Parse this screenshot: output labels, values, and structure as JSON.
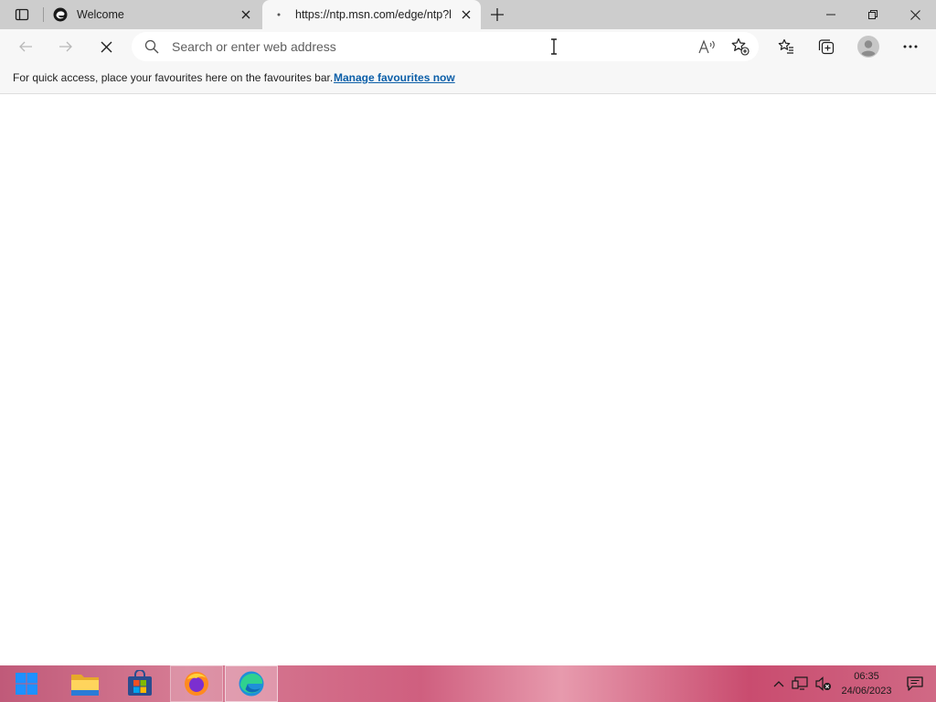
{
  "tabs": [
    {
      "title": "Welcome",
      "icon": "edge-logo-icon",
      "active": false
    },
    {
      "title": "https://ntp.msn.com/edge/ntp?l",
      "icon": "loading-dot-icon",
      "active": true
    }
  ],
  "address_bar": {
    "placeholder": "Search or enter web address",
    "value": ""
  },
  "favourites_bar": {
    "message": "For quick access, place your favourites here on the favourites bar.",
    "link_label": "Manage favourites now"
  },
  "taskbar": {
    "apps": [
      "start",
      "file-explorer",
      "microsoft-store",
      "firefox",
      "edge"
    ],
    "clock_time": "06:35",
    "clock_date": "24/06/2023"
  },
  "colors": {
    "tabstrip": "#cdcdcd",
    "toolbar": "#f7f7f7",
    "link": "#0c5fa8"
  }
}
